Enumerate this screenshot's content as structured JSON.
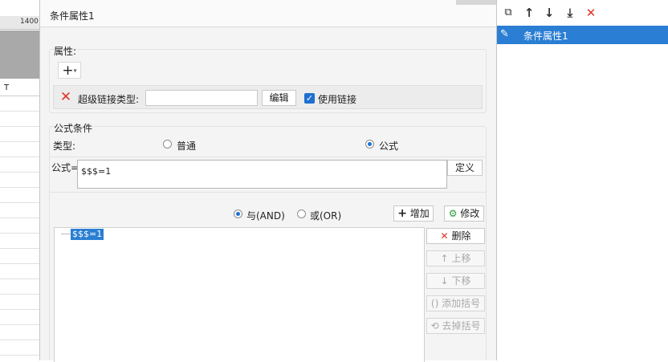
{
  "sheet": {
    "ruler_number": "1400",
    "column_letter": "T"
  },
  "dialog": {
    "title": "条件属性1",
    "attributes": {
      "label": "属性:",
      "add_icon": "plus-dropdown-icon",
      "hyperlink_type_label": "超级链接类型:",
      "hyperlink_value": "",
      "edit_button": "编辑",
      "use_link_label": "使用链接",
      "use_link_checked": true
    },
    "formula_condition": {
      "label": "公式条件",
      "type_label": "类型:",
      "option_normal": "普通",
      "option_formula": "公式",
      "selected": "公式",
      "formula_label": "公式=",
      "formula_value": "$$$=1",
      "define_button": "定义"
    },
    "logic": {
      "and_label": "与(AND)",
      "or_label": "或(OR)",
      "selected": "AND",
      "add_button": "增加",
      "modify_button": "修改"
    },
    "condition_list": [
      "$$$=1"
    ],
    "side_buttons": {
      "delete": "删除",
      "move_up": "上移",
      "move_down": "下移",
      "add_bracket": "添加括号",
      "remove_bracket": "去掉括号"
    }
  },
  "right_panel": {
    "toolbar_icons": [
      "copy-icon",
      "arrow-up-icon",
      "arrow-down-icon",
      "move-to-bottom-icon",
      "delete-icon"
    ],
    "items": [
      {
        "label": "条件属性1",
        "selected": true
      }
    ]
  },
  "colors": {
    "accent": "#2a7ed3",
    "delete_red": "#e0342b",
    "check_blue": "#1e6fd0"
  }
}
